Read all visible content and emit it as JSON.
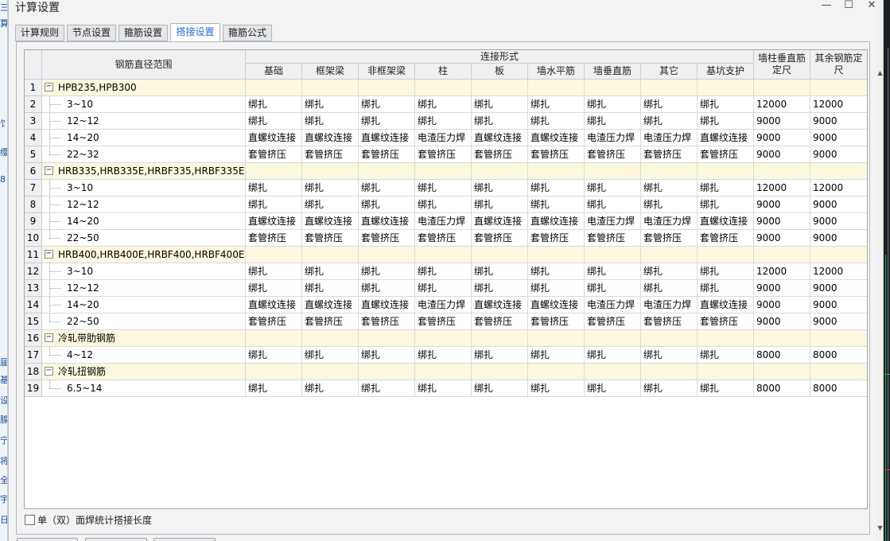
{
  "window": {
    "title": "计算设置",
    "minimize_glyph": "—",
    "maximize_glyph": "☐",
    "close_glyph": "✕"
  },
  "tabs": [
    {
      "label": "计算规则",
      "active": false
    },
    {
      "label": "节点设置",
      "active": false
    },
    {
      "label": "箍筋设置",
      "active": false
    },
    {
      "label": "搭接设置",
      "active": true
    },
    {
      "label": "箍筋公式",
      "active": false
    }
  ],
  "table": {
    "header": {
      "range": "钢筋直径范围",
      "connection_group": "连接形式",
      "columns": [
        "基础",
        "框架梁",
        "非框架梁",
        "柱",
        "板",
        "墙水平筋",
        "墙垂直筋",
        "其它",
        "基坑支护"
      ],
      "wall_col_len": "墙柱垂直筋定尺",
      "other_len": "其余钢筋定尺"
    },
    "rows": [
      {
        "num": "1",
        "type": "group",
        "label": "HPB235,HPB300"
      },
      {
        "num": "2",
        "type": "item",
        "label": "3~10",
        "values": [
          "绑扎",
          "绑扎",
          "绑扎",
          "绑扎",
          "绑扎",
          "绑扎",
          "绑扎",
          "绑扎",
          "绑扎"
        ],
        "wall_len": "12000",
        "other_len": "12000"
      },
      {
        "num": "3",
        "type": "item",
        "label": "12~12",
        "values": [
          "绑扎",
          "绑扎",
          "绑扎",
          "绑扎",
          "绑扎",
          "绑扎",
          "绑扎",
          "绑扎",
          "绑扎"
        ],
        "wall_len": "9000",
        "other_len": "9000"
      },
      {
        "num": "4",
        "type": "item",
        "label": "14~20",
        "values": [
          "直螺纹连接",
          "直螺纹连接",
          "直螺纹连接",
          "电渣压力焊",
          "直螺纹连接",
          "直螺纹连接",
          "电渣压力焊",
          "电渣压力焊",
          "直螺纹连接"
        ],
        "wall_len": "9000",
        "other_len": "9000"
      },
      {
        "num": "5",
        "type": "item",
        "label": "22~32",
        "values": [
          "套管挤压",
          "套管挤压",
          "套管挤压",
          "套管挤压",
          "套管挤压",
          "套管挤压",
          "套管挤压",
          "套管挤压",
          "套管挤压"
        ],
        "wall_len": "9000",
        "other_len": "9000"
      },
      {
        "num": "6",
        "type": "group",
        "label": "HRB335,HRB335E,HRBF335,HRBF335E"
      },
      {
        "num": "7",
        "type": "item",
        "label": "3~10",
        "values": [
          "绑扎",
          "绑扎",
          "绑扎",
          "绑扎",
          "绑扎",
          "绑扎",
          "绑扎",
          "绑扎",
          "绑扎"
        ],
        "wall_len": "12000",
        "other_len": "12000"
      },
      {
        "num": "8",
        "type": "item",
        "label": "12~12",
        "values": [
          "绑扎",
          "绑扎",
          "绑扎",
          "绑扎",
          "绑扎",
          "绑扎",
          "绑扎",
          "绑扎",
          "绑扎"
        ],
        "wall_len": "9000",
        "other_len": "9000"
      },
      {
        "num": "9",
        "type": "item",
        "label": "14~20",
        "values": [
          "直螺纹连接",
          "直螺纹连接",
          "直螺纹连接",
          "电渣压力焊",
          "直螺纹连接",
          "直螺纹连接",
          "电渣压力焊",
          "电渣压力焊",
          "直螺纹连接"
        ],
        "wall_len": "9000",
        "other_len": "9000"
      },
      {
        "num": "10",
        "type": "item",
        "label": "22~50",
        "values": [
          "套管挤压",
          "套管挤压",
          "套管挤压",
          "套管挤压",
          "套管挤压",
          "套管挤压",
          "套管挤压",
          "套管挤压",
          "套管挤压"
        ],
        "wall_len": "9000",
        "other_len": "9000"
      },
      {
        "num": "11",
        "type": "group",
        "label": "HRB400,HRB400E,HRBF400,HRBF400E..."
      },
      {
        "num": "12",
        "type": "item",
        "label": "3~10",
        "values": [
          "绑扎",
          "绑扎",
          "绑扎",
          "绑扎",
          "绑扎",
          "绑扎",
          "绑扎",
          "绑扎",
          "绑扎"
        ],
        "wall_len": "12000",
        "other_len": "12000"
      },
      {
        "num": "13",
        "type": "item",
        "label": "12~12",
        "values": [
          "绑扎",
          "绑扎",
          "绑扎",
          "绑扎",
          "绑扎",
          "绑扎",
          "绑扎",
          "绑扎",
          "绑扎"
        ],
        "wall_len": "9000",
        "other_len": "9000"
      },
      {
        "num": "14",
        "type": "item",
        "label": "14~20",
        "values": [
          "直螺纹连接",
          "直螺纹连接",
          "直螺纹连接",
          "电渣压力焊",
          "直螺纹连接",
          "直螺纹连接",
          "电渣压力焊",
          "电渣压力焊",
          "直螺纹连接"
        ],
        "wall_len": "9000",
        "other_len": "9000"
      },
      {
        "num": "15",
        "type": "item",
        "label": "22~50",
        "values": [
          "套管挤压",
          "套管挤压",
          "套管挤压",
          "套管挤压",
          "套管挤压",
          "套管挤压",
          "套管挤压",
          "套管挤压",
          "套管挤压"
        ],
        "wall_len": "9000",
        "other_len": "9000"
      },
      {
        "num": "16",
        "type": "group",
        "label": "冷轧带肋钢筋"
      },
      {
        "num": "17",
        "type": "item",
        "label": "4~12",
        "values": [
          "绑扎",
          "绑扎",
          "绑扎",
          "绑扎",
          "绑扎",
          "绑扎",
          "绑扎",
          "绑扎",
          "绑扎"
        ],
        "wall_len": "8000",
        "other_len": "8000"
      },
      {
        "num": "18",
        "type": "group",
        "label": "冷轧扭钢筋"
      },
      {
        "num": "19",
        "type": "item",
        "label": "6.5~14",
        "values": [
          "绑扎",
          "绑扎",
          "绑扎",
          "绑扎",
          "绑扎",
          "绑扎",
          "绑扎",
          "绑扎",
          "绑扎"
        ],
        "wall_len": "8000",
        "other_len": "8000"
      }
    ]
  },
  "footer": {
    "checkbox_label": "单（双）面焊统计搭接长度",
    "checked": false
  },
  "background": {
    "left_glyphs": [
      "三",
      "算",
      "饣",
      "缨",
      "8",
      "届",
      "基",
      "设",
      "腺",
      "宁",
      "将",
      "全",
      "宇",
      "日"
    ]
  }
}
